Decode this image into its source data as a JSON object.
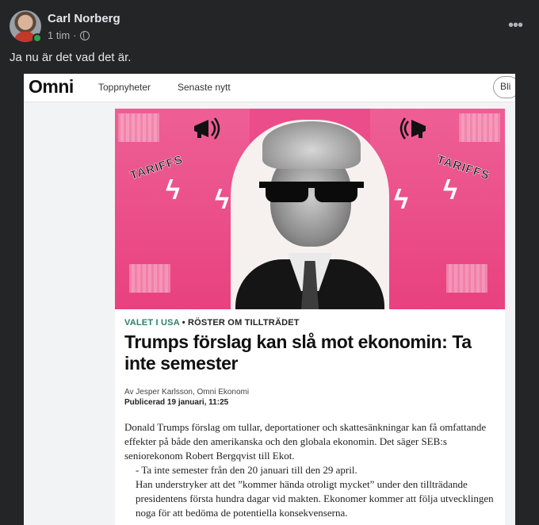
{
  "post": {
    "author": "Carl Norberg",
    "time": "1 tim",
    "separator": "·",
    "text": "Ja nu är det vad det är.",
    "more_label": "•••"
  },
  "omni": {
    "logo": "Omni",
    "nav": [
      "Toppnyheter",
      "Senaste nytt"
    ],
    "pill_label": "Bli"
  },
  "article": {
    "hero_tags": [
      "TARIFFS",
      "TARIFFS"
    ],
    "kicker_primary": "VALET I USA",
    "kicker_sep": " • ",
    "kicker_secondary": "RÖSTER OM TILLTRÄDET",
    "headline": "Trumps förslag kan slå mot ekonomin: Ta inte semester",
    "byline": "Av Jesper Karlsson, Omni Ekonomi",
    "published_label": "Publicerad",
    "published_date": "19 januari, 11:25",
    "paragraphs": [
      "Donald Trumps förslag om tullar, deportationer och skattesänkningar kan få omfattande effekter på både den amerikanska och den globala ekonomin. Det säger SEB:s seniorekonom Robert Bergqvist till Ekot.",
      "- Ta inte semester från den 20 januari till den 29 april.",
      "Han understryker att det ”kommer hända otroligt mycket” under den tillträdande presidentens första hundra dagar vid makten. Ekonomer kommer att följa utvecklingen noga för att bedöma de potentiella konsekvenserna."
    ]
  },
  "colors": {
    "hero_pink": "#ea4d8a",
    "kicker_green": "#2e7d6b",
    "online_green": "#31a24c",
    "post_bg": "#242526"
  }
}
